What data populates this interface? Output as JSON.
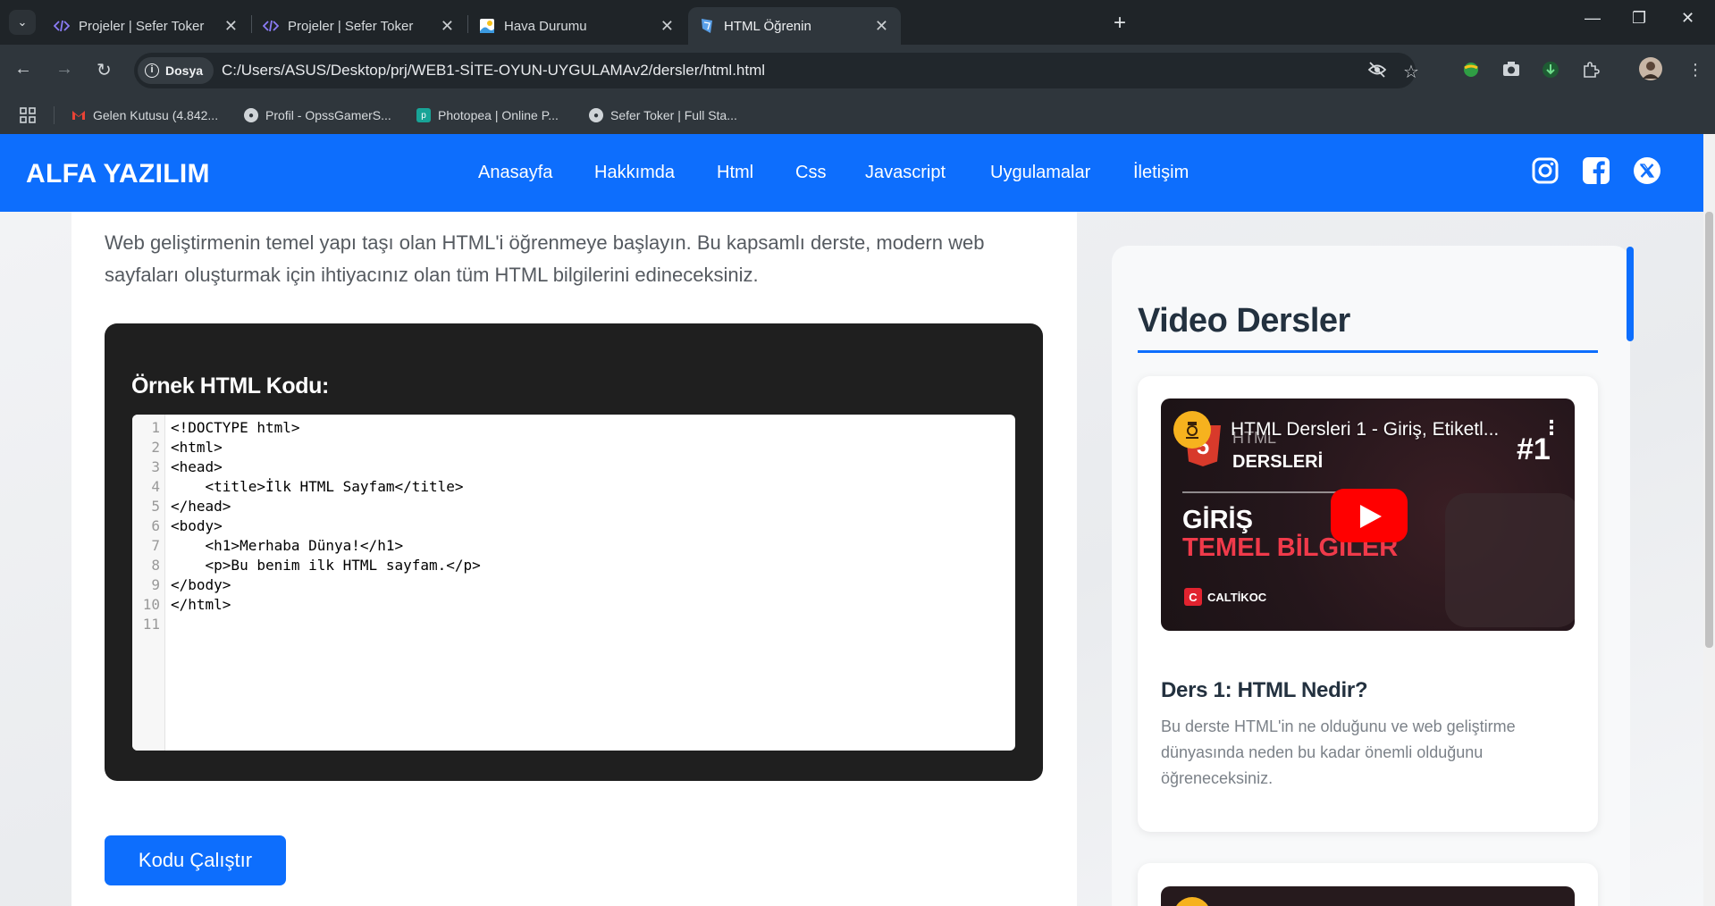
{
  "browser": {
    "tabs": [
      {
        "title": "Projeler | Sefer Toker",
        "active": false
      },
      {
        "title": "Projeler | Sefer Toker",
        "active": false
      },
      {
        "title": "Hava Durumu",
        "active": false
      },
      {
        "title": "HTML Öğrenin",
        "active": true
      }
    ],
    "site_chip": "Dosya",
    "url": "C:/Users/ASUS/Desktop/prj/WEB1-SİTE-OYUN-UYGULAMAv2/dersler/html.html",
    "bookmarks": [
      "Gelen Kutusu (4.842...",
      "Profil - OpssGamerS...",
      "Photopea | Online P...",
      "Sefer Toker | Full Sta..."
    ]
  },
  "site": {
    "logo": "ALFA YAZILIM",
    "nav": [
      "Anasayfa",
      "Hakkımda",
      "Html",
      "Css",
      "Javascript",
      "Uygulamalar",
      "İletişim"
    ],
    "social_icons": [
      "instagram-icon",
      "facebook-icon",
      "x-twitter-icon"
    ],
    "brand_color": "#0d6efd"
  },
  "main": {
    "intro": "Web geliştirmenin temel yapı taşı olan HTML'i öğrenmeye başlayın. Bu kapsamlı derste, modern web sayfaları oluşturmak için ihtiyacınız olan tüm HTML bilgilerini edineceksiniz.",
    "code_title": "Örnek HTML Kodu:",
    "code_lines": [
      "<!DOCTYPE html>",
      "<html>",
      "<head>",
      "    <title>İlk HTML Sayfam</title>",
      "</head>",
      "<body>",
      "    <h1>Merhaba Dünya!</h1>",
      "    <p>Bu benim ilk HTML sayfam.</p>",
      "</body>",
      "</html>",
      ""
    ],
    "line_numbers": [
      "1",
      "2",
      "3",
      "4",
      "5",
      "6",
      "7",
      "8",
      "9",
      "10",
      "11"
    ],
    "run_button": "Kodu Çalıştır"
  },
  "sidebar": {
    "title": "Video Dersler",
    "videos": [
      {
        "yt_title": "HTML Dersleri 1 - Giriş, Etiketl...",
        "thumb_html": "HTML",
        "thumb_dersleri": "DERSLERİ",
        "thumb_num": "#1",
        "thumb_giris": "GİRİŞ",
        "thumb_temel": "TEMEL BİLGİLER",
        "thumb_brand": "CALTİKOC",
        "title": "Ders 1: HTML Nedir?",
        "desc": "Bu derste HTML'in ne olduğunu ve web geliştirme dünyasında neden bu kadar önemli olduğunu öğreneceksiniz."
      }
    ]
  }
}
